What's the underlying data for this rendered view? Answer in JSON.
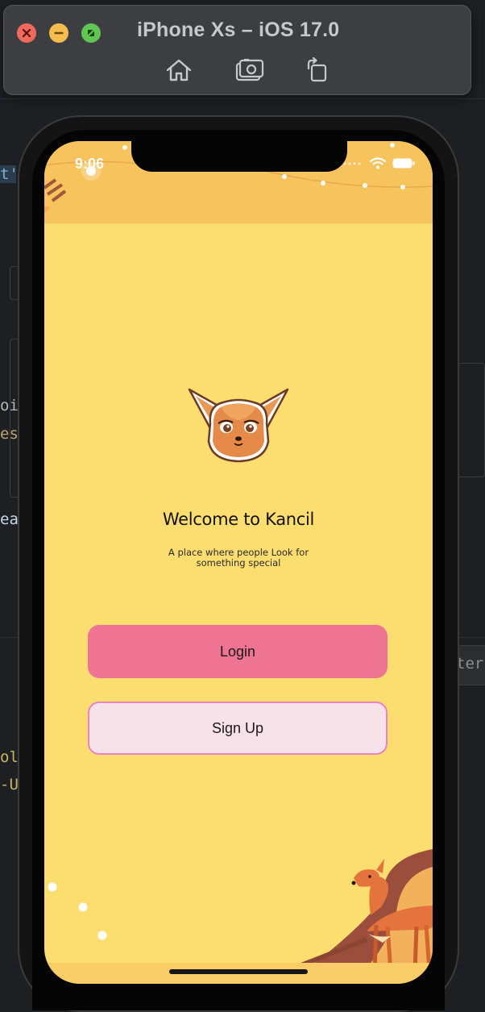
{
  "simulator": {
    "title": "iPhone Xs – iOS 17.0",
    "toolbar": [
      "home-icon",
      "screenshot-icon",
      "rotate-icon"
    ]
  },
  "background_editor": {
    "fragments": [
      "t'",
      "oi",
      "es",
      "ea",
      "ter",
      "ol",
      "-U"
    ]
  },
  "status_bar": {
    "time": "9:06"
  },
  "app": {
    "welcome_title": "Welcome to Kancil",
    "tagline": "A place where people Look for something special",
    "login_label": "Login",
    "signup_label": "Sign Up",
    "colors": {
      "background": "#fcdd6f",
      "header": "#f6c35d",
      "login_button": "#ef7494",
      "signup_button": "#f8e2ea",
      "signup_border": "#e983c3"
    }
  }
}
